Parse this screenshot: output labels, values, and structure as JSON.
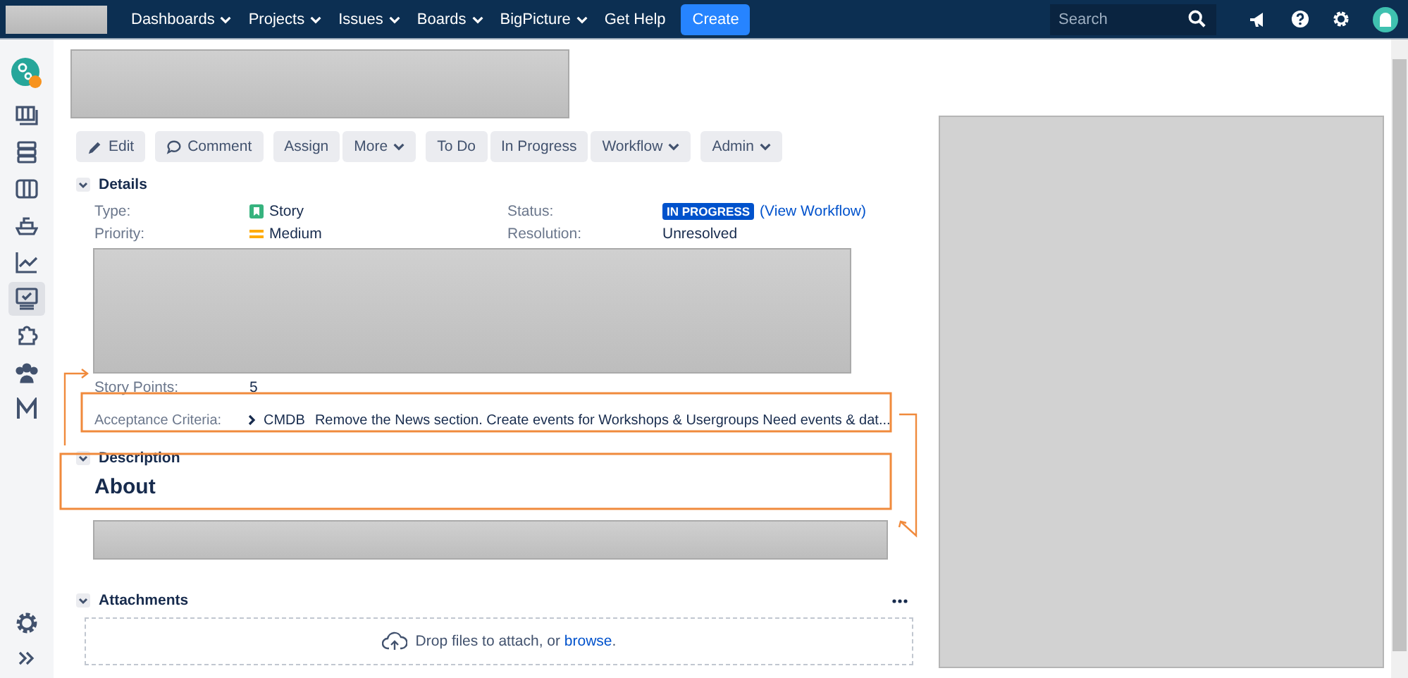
{
  "nav": {
    "items": [
      {
        "label": "Dashboards",
        "dropdown": true
      },
      {
        "label": "Projects",
        "dropdown": true
      },
      {
        "label": "Issues",
        "dropdown": true
      },
      {
        "label": "Boards",
        "dropdown": true
      },
      {
        "label": "BigPicture",
        "dropdown": true
      },
      {
        "label": "Get Help",
        "dropdown": false
      }
    ],
    "create": "Create",
    "search": {
      "placeholder": "Search"
    }
  },
  "sidebar": {
    "items": [
      {
        "selected": false
      },
      {
        "selected": false
      },
      {
        "selected": false
      },
      {
        "selected": false
      },
      {
        "selected": false
      },
      {
        "selected": false
      },
      {
        "selected": true
      },
      {
        "selected": false
      },
      {
        "selected": false
      },
      {
        "selected": false
      }
    ]
  },
  "toolbar": [
    {
      "label": "Edit",
      "dropdown": false
    },
    {
      "label": "Comment",
      "dropdown": false
    },
    {
      "label": "Assign",
      "dropdown": false
    },
    {
      "label": "More",
      "dropdown": true
    },
    {
      "label": "To Do",
      "dropdown": false
    },
    {
      "label": "In Progress",
      "dropdown": false
    },
    {
      "label": "Workflow",
      "dropdown": true
    },
    {
      "label": "Admin",
      "dropdown": true
    }
  ],
  "details": {
    "heading": "Details",
    "type_label": "Type:",
    "type_value": "Story",
    "priority_label": "Priority:",
    "priority_value": "Medium",
    "status_label": "Status:",
    "status_value": "IN PROGRESS",
    "status_link": "(View Workflow)",
    "resolution_label": "Resolution:",
    "resolution_value": "Unresolved",
    "story_points_label": "Story Points:",
    "story_points_value": "5",
    "acceptance_label": "Acceptance Criteria:",
    "acceptance_key": "CMDB",
    "acceptance_value": "Remove the News section. Create events for Workshops & Usergroups Need events & dat..."
  },
  "description": {
    "heading": "Description",
    "title": "About"
  },
  "attachments": {
    "heading": "Attachments",
    "drop_text": "Drop files to attach, or ",
    "browse_link": "browse",
    "drop_end": "."
  }
}
